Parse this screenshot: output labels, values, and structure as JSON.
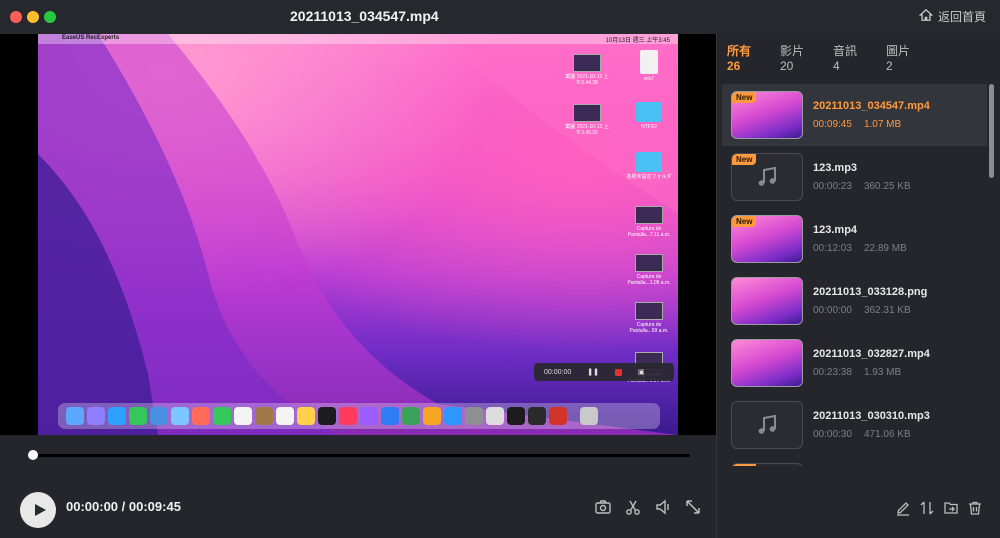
{
  "window": {
    "title": "20211013_034547.mp4",
    "home_label": "返回首頁"
  },
  "screen": {
    "menubar_app": "EaseUS RecExperts",
    "menubar_clock": "10月13日 週三 上午3:45",
    "desktop_icons": [
      {
        "label": "截圖 2021-10-13 上午3.44.38",
        "kind": "thumb"
      },
      {
        "label": "win7",
        "kind": "file"
      },
      {
        "label": "截圖 2021-10-13 上午3.45.32",
        "kind": "thumb"
      },
      {
        "label": "NTFS2",
        "kind": "folder"
      },
      {
        "label": "名称未設定フォルダ",
        "kind": "folder"
      },
      {
        "label": "Captura de Pantalla...7.11 a.m.",
        "kind": "thumb"
      },
      {
        "label": "Captura de Pantalla...1.09 a.m.",
        "kind": "thumb"
      },
      {
        "label": "Captura de Pantalla...59 a.m.",
        "kind": "thumb"
      },
      {
        "label": "Captura de Pantalla...0.54 a.m.",
        "kind": "thumb"
      }
    ],
    "recording_timer": "00:00:00"
  },
  "player": {
    "current_time": "00:00:00",
    "total_time": "00:09:45",
    "progress": 0.0,
    "icons": [
      "camera-icon",
      "scissors-icon",
      "speaker-icon",
      "expand-icon"
    ]
  },
  "sidebar": {
    "tabs": [
      {
        "label": "所有",
        "count": "26",
        "active": true
      },
      {
        "label": "影片",
        "count": "20",
        "active": false
      },
      {
        "label": "音訊",
        "count": "4",
        "active": false
      },
      {
        "label": "圖片",
        "count": "2",
        "active": false
      }
    ],
    "items": [
      {
        "name": "20211013_034547.mp4",
        "duration": "00:09:45",
        "size": "1.07 MB",
        "type": "video",
        "is_new": true,
        "selected": true
      },
      {
        "name": "123.mp3",
        "duration": "00:00:23",
        "size": "360.25 KB",
        "type": "audio",
        "is_new": true,
        "selected": false
      },
      {
        "name": "123.mp4",
        "duration": "00:12:03",
        "size": "22.89 MB",
        "type": "video",
        "is_new": true,
        "selected": false
      },
      {
        "name": "20211013_033128.png",
        "duration": "00:00:00",
        "size": "362.31 KB",
        "type": "video",
        "is_new": false,
        "selected": false
      },
      {
        "name": "20211013_032827.mp4",
        "duration": "00:23:38",
        "size": "1.93 MB",
        "type": "video",
        "is_new": false,
        "selected": false
      },
      {
        "name": "20211013_030310.mp3",
        "duration": "00:00:30",
        "size": "471.06 KB",
        "type": "audio",
        "is_new": false,
        "selected": false
      },
      {
        "name": "",
        "duration": "",
        "size": "",
        "type": "audio",
        "is_new": true,
        "selected": false
      }
    ],
    "new_badge": "New",
    "icons": [
      "edit-icon",
      "sort-icon",
      "export-icon",
      "delete-icon"
    ]
  },
  "colors": {
    "accent": "#ff9a3c",
    "background": "#25262c",
    "selected_row": "#33353c"
  }
}
